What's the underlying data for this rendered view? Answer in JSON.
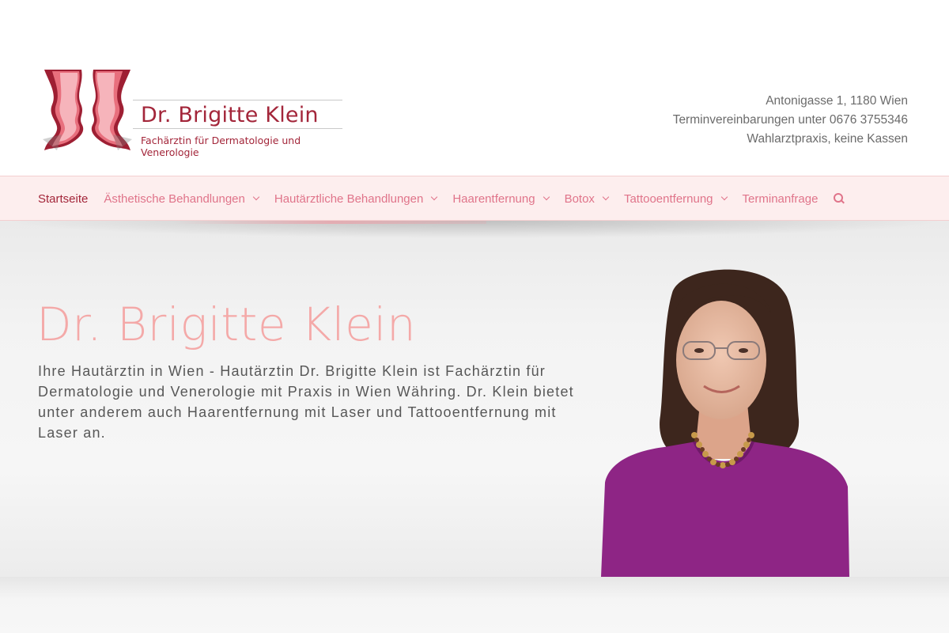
{
  "brand": {
    "name": "Dr. Brigitte Klein",
    "subtitle": "Fachärztin für Dermatologie und Venerologie",
    "logo_icon": "butterfly-faces-logo",
    "color": "#a3263a"
  },
  "contact": {
    "address": "Antonigasse 1, 1180 Wien",
    "phone": "Terminvereinbarungen unter 0676 3755346",
    "note": "Wahlarztpraxis, keine Kassen"
  },
  "nav": {
    "items": [
      {
        "label": "Startseite",
        "dropdown": false
      },
      {
        "label": "Ästhetische Behandlungen",
        "dropdown": true
      },
      {
        "label": "Hautärztliche Behandlungen",
        "dropdown": true
      },
      {
        "label": "Haarentfernung",
        "dropdown": true
      },
      {
        "label": "Botox",
        "dropdown": true
      },
      {
        "label": "Tattooentfernung",
        "dropdown": true
      },
      {
        "label": "Terminanfrage",
        "dropdown": false
      }
    ],
    "search_icon": "search-icon",
    "accent": "#e0748a"
  },
  "hero": {
    "title": "Dr. Brigitte Klein",
    "text": "Ihre Hautärztin in Wien - Hautärztin Dr. Brigitte Klein ist Fachärztin für Dermatologie und Venerologie mit Praxis in Wien Währing. Dr. Klein bietet unter anderem auch Haarentfernung mit Laser und Tattooentfernung mit Laser an.",
    "title_color": "#f4a9a8"
  }
}
